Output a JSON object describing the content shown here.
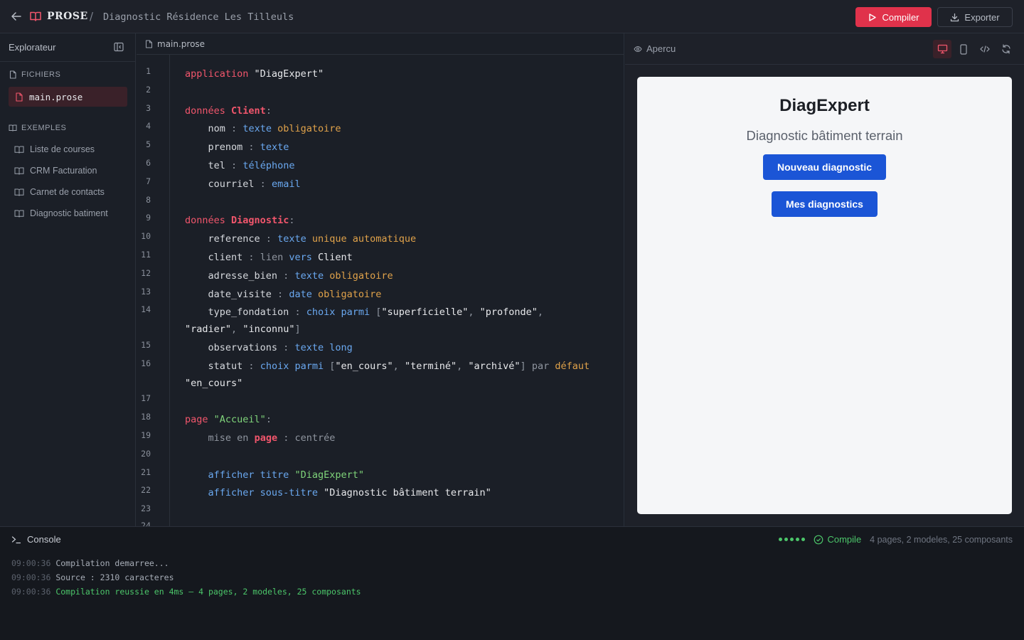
{
  "header": {
    "brand": "PROSE",
    "separator": "/",
    "project_title": "Diagnostic Résidence Les Tilleuls",
    "compile_label": "Compiler",
    "export_label": "Exporter"
  },
  "sidebar": {
    "title": "Explorateur",
    "files_section": "FICHIERS",
    "files": [
      {
        "name": "main.prose"
      }
    ],
    "examples_section": "EXEMPLES",
    "examples": [
      {
        "label": "Liste de courses"
      },
      {
        "label": "CRM Facturation"
      },
      {
        "label": "Carnet de contacts"
      },
      {
        "label": "Diagnostic batiment"
      }
    ]
  },
  "editor": {
    "tab_name": "main.prose",
    "line_numbers": [
      "1",
      "2",
      "3",
      "4",
      "5",
      "6",
      "7",
      "8",
      "9",
      "10",
      "11",
      "12",
      "13",
      "14",
      "15",
      "16",
      "17",
      "18",
      "19",
      "20",
      "21",
      "22",
      "23",
      "24"
    ]
  },
  "preview": {
    "title": "Apercu",
    "app": {
      "title": "DiagExpert",
      "subtitle": "Diagnostic bâtiment terrain",
      "buttons": [
        {
          "label": "Nouveau diagnostic"
        },
        {
          "label": "Mes diagnostics"
        }
      ]
    }
  },
  "console": {
    "title": "Console",
    "status": "Compile",
    "stats": "4 pages, 2 modeles, 25 composants",
    "logs": [
      {
        "time": "09:00:36",
        "message": "Compilation demarree..."
      },
      {
        "time": "09:00:36",
        "message": "Source : 2310 caracteres"
      },
      {
        "time": "09:00:36",
        "message": "Compilation reussie en 4ms — 4 pages, 2 modeles, 25 composants"
      }
    ]
  },
  "colors": {
    "accent": "#e0324b",
    "app_button": "#1b55d6",
    "success": "#4cc66a"
  }
}
